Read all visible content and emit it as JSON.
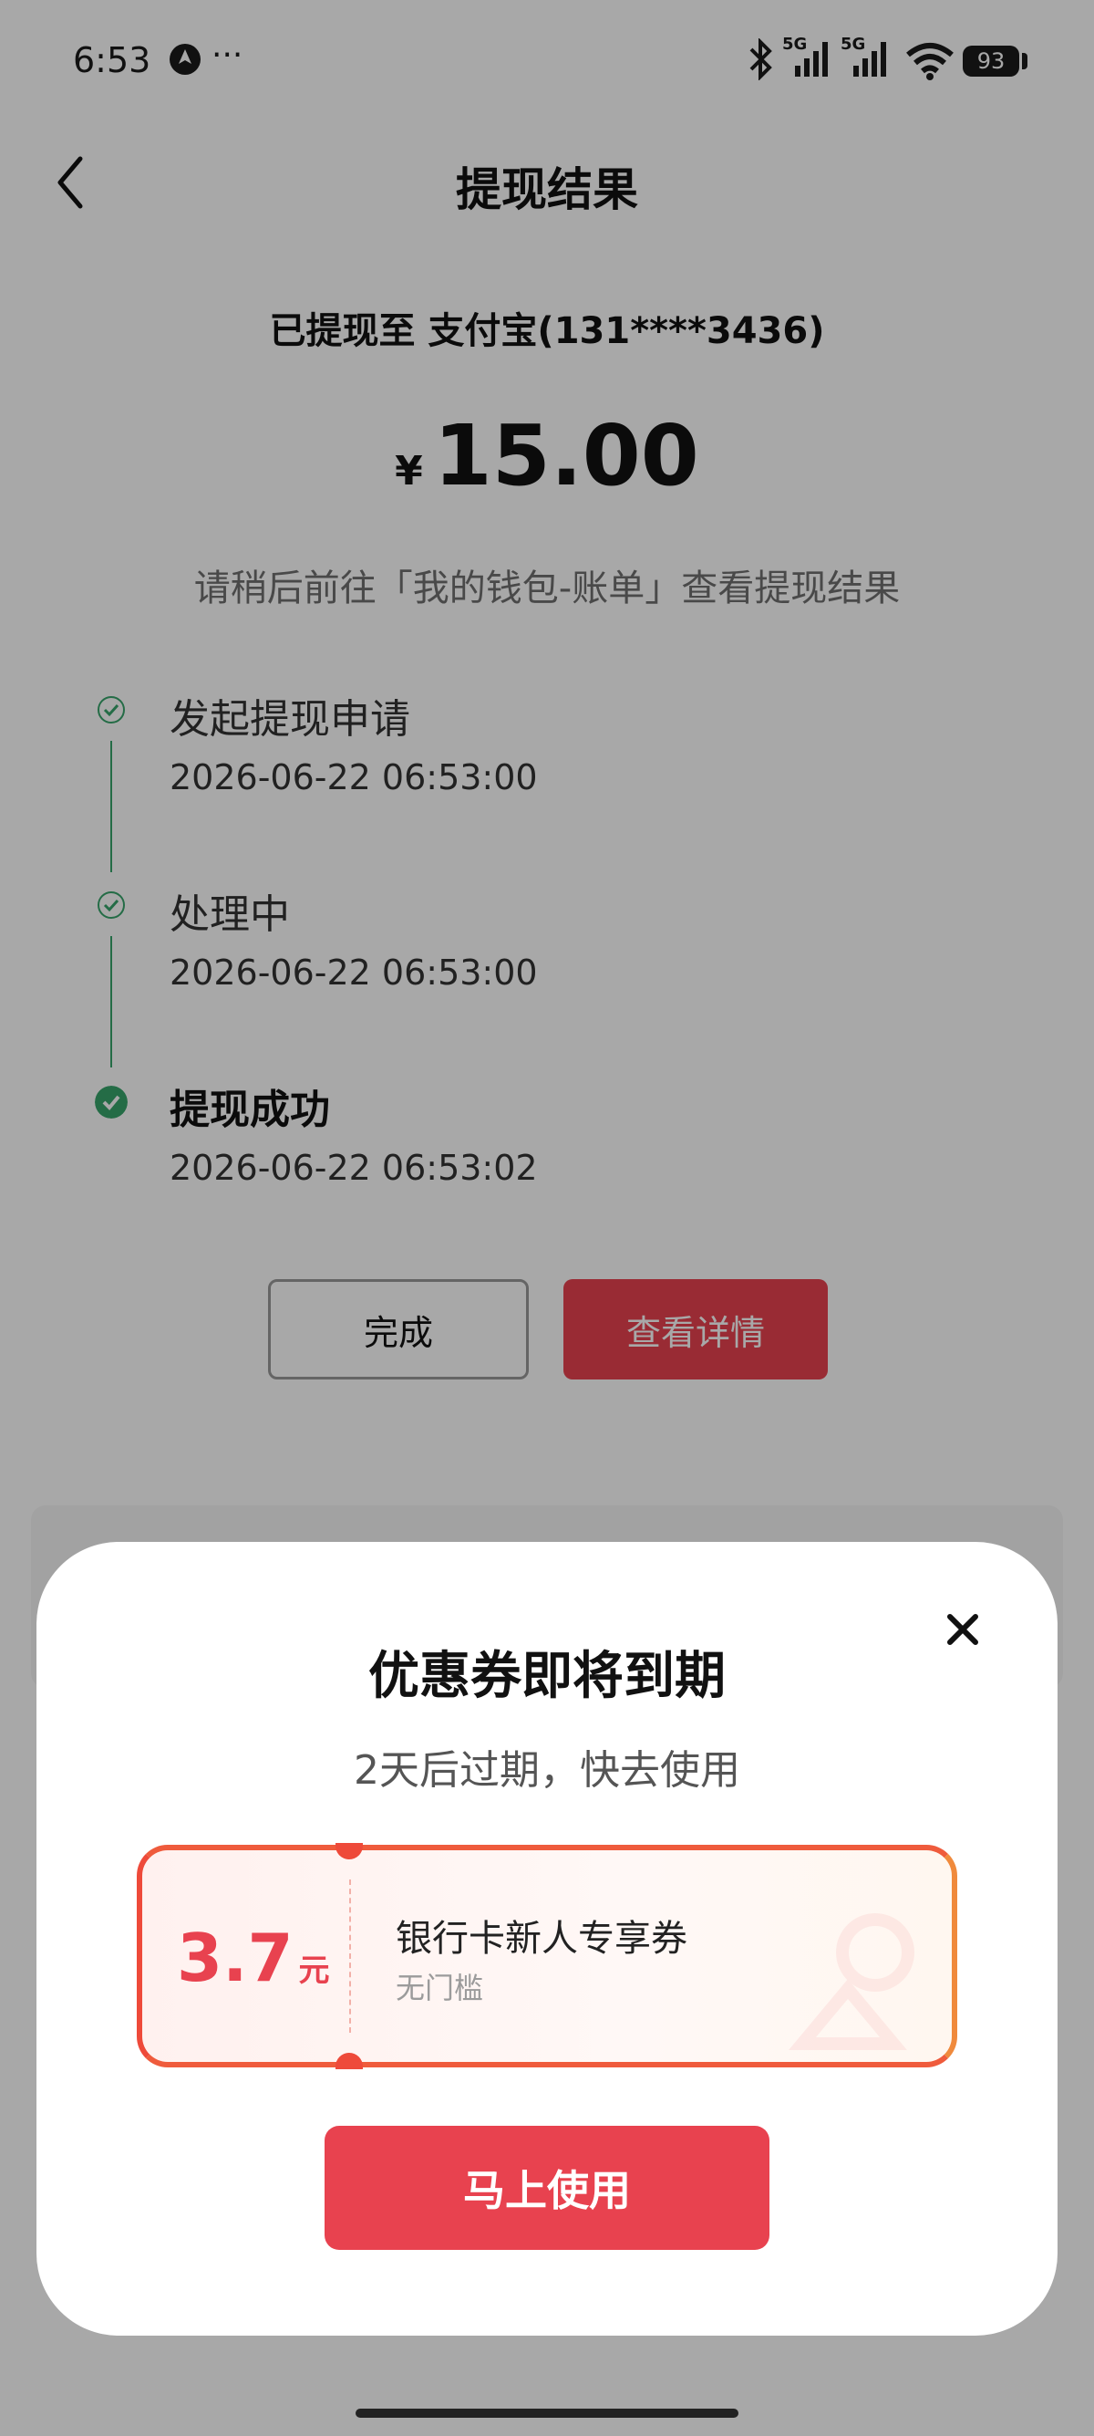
{
  "status_bar": {
    "time": "6:53",
    "more": "···",
    "battery": "93",
    "network_labels": [
      "5G",
      "5G"
    ]
  },
  "header": {
    "title": "提现结果"
  },
  "result": {
    "destination": "已提现至 支付宝(131****3436)",
    "currency_symbol": "¥",
    "amount": "15.00",
    "hint": "请稍后前往「我的钱包-账单」查看提现结果"
  },
  "steps": [
    {
      "label": "发起提现申请",
      "time": "2026-06-22 06:53:00",
      "state": "done"
    },
    {
      "label": "处理中",
      "time": "2026-06-22 06:53:00",
      "state": "done"
    },
    {
      "label": "提现成功",
      "time": "2026-06-22 06:53:02",
      "state": "current"
    }
  ],
  "actions": {
    "done_label": "完成",
    "detail_label": "查看详情"
  },
  "modal": {
    "title": "优惠券即将到期",
    "subtitle": "2天后过期，快去使用",
    "coupon": {
      "value": "3.7",
      "unit": "元",
      "name": "银行卡新人专享券",
      "condition": "无门槛"
    },
    "use_button_label": "马上使用"
  },
  "colors": {
    "accent_red": "#e8424f",
    "success_green": "#38a46b",
    "coupon_border": "#ee4a3a",
    "coupon_border_end": "#f08a3c"
  }
}
